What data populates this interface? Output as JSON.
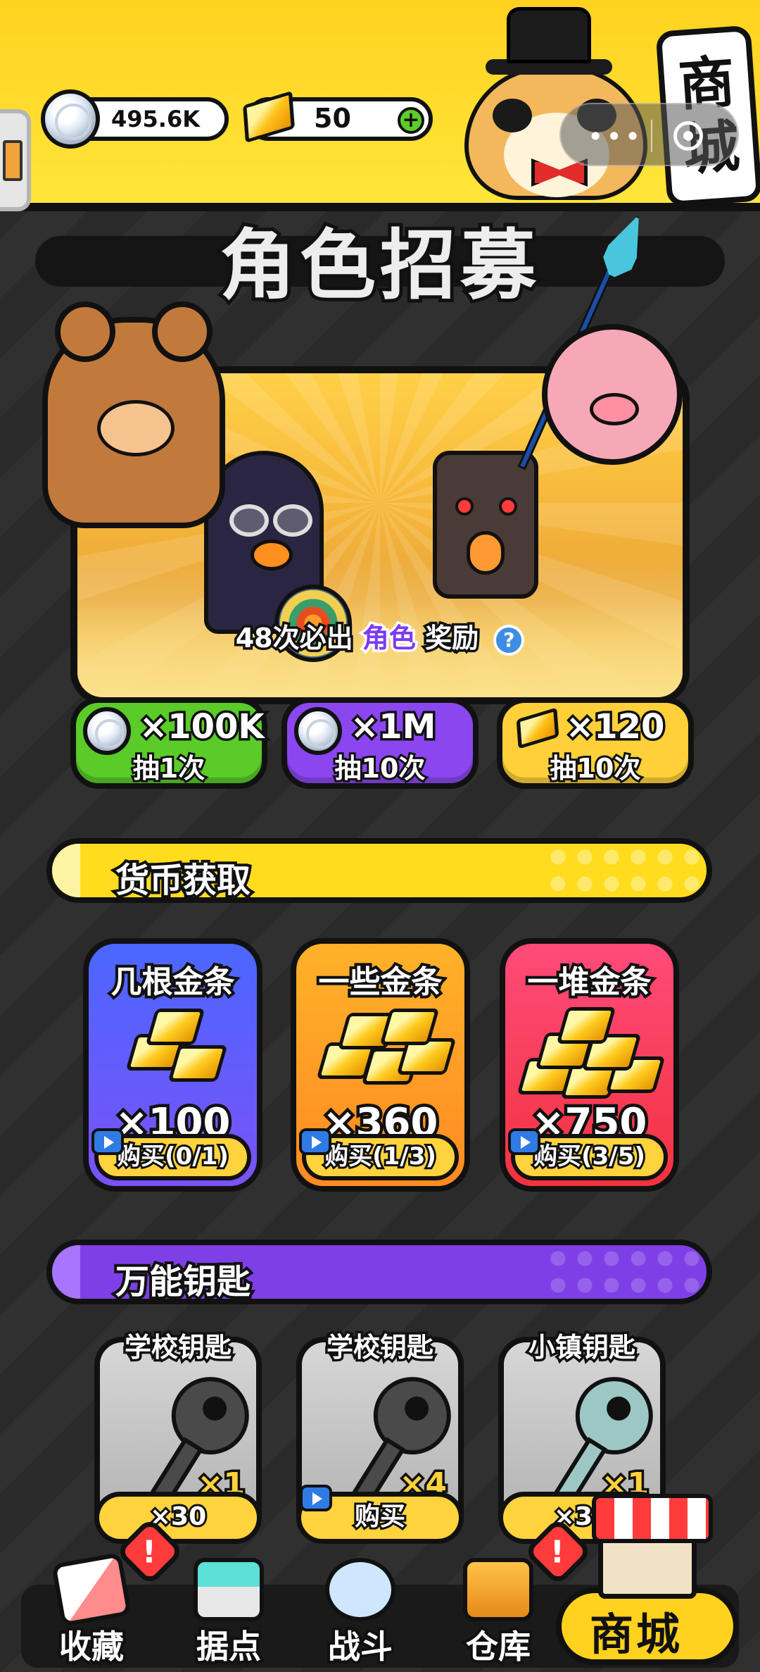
{
  "header": {
    "silver_amount": "495.6K",
    "gold_amount": "50",
    "shop_sign": "商城"
  },
  "recruit": {
    "title": "角色招募",
    "pity_prefix": "48次必出",
    "pity_highlight": "角色",
    "pity_suffix": "奖励",
    "help": "?",
    "buttons": [
      {
        "cost": "×100K",
        "label": "抽1次",
        "currency": "silver",
        "color": "#5acb29"
      },
      {
        "cost": "×1M",
        "label": "抽10次",
        "currency": "silver",
        "color": "#8b46f0"
      },
      {
        "cost": "×120",
        "label": "抽10次",
        "currency": "gold",
        "color": "#ffd03a"
      }
    ]
  },
  "currency_section": {
    "title": "货币获取",
    "cards": [
      {
        "name": "几根金条",
        "qty": "×100",
        "buy": "购买(0/1)"
      },
      {
        "name": "一些金条",
        "qty": "×360",
        "buy": "购买(1/3)"
      },
      {
        "name": "一堆金条",
        "qty": "×750",
        "buy": "购买(3/5)"
      }
    ]
  },
  "keys_section": {
    "title": "万能钥匙",
    "cards": [
      {
        "name": "学校钥匙",
        "qty": "×1",
        "button": "×30"
      },
      {
        "name": "学校钥匙",
        "qty": "×4",
        "button": "购买"
      },
      {
        "name": "小镇钥匙",
        "qty": "×1",
        "button": "×30"
      }
    ]
  },
  "nav": {
    "items": [
      {
        "label": "收藏",
        "icon": "book-icon"
      },
      {
        "label": "据点",
        "icon": "base-icon"
      },
      {
        "label": "战斗",
        "icon": "battle-icon"
      },
      {
        "label": "仓库",
        "icon": "warehouse-icon"
      },
      {
        "label": "商城",
        "icon": "shop-icon"
      }
    ],
    "alert_mark": "!"
  }
}
